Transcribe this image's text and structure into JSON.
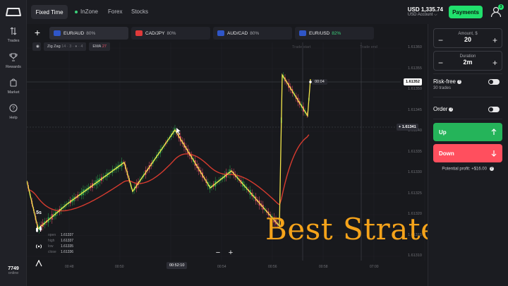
{
  "sidebar": {
    "items": [
      {
        "label": "Trades",
        "icon": "arrows-updown-icon"
      },
      {
        "label": "Rewards",
        "icon": "trophy-icon"
      },
      {
        "label": "Market",
        "icon": "cart-icon"
      },
      {
        "label": "Help",
        "icon": "help-icon"
      }
    ],
    "online_count": "7749",
    "online_label": "online"
  },
  "header": {
    "tabs": [
      {
        "label": "Fixed Time"
      },
      {
        "label": "InZone"
      },
      {
        "label": "Forex"
      },
      {
        "label": "Stocks"
      }
    ],
    "balance": "USD 1,335.74",
    "account_label": "USD Account",
    "payments_label": "Payments",
    "notification_count": "3"
  },
  "assets": [
    {
      "name": "EUR/AUD",
      "payout": "80%"
    },
    {
      "name": "CAD/JPY",
      "payout": "80%"
    },
    {
      "name": "AUD/CAD",
      "payout": "80%"
    },
    {
      "name": "EUR/USD",
      "payout": "82%"
    }
  ],
  "indicators": [
    {
      "name": "Zig Zag",
      "params": "14 · 3 · ● · 4"
    },
    {
      "name": "EMA",
      "params": "27"
    }
  ],
  "chart": {
    "timeframe": "5s",
    "ohlc": [
      {
        "key": "open",
        "value": "1.61337"
      },
      {
        "key": "high",
        "value": "1.61337"
      },
      {
        "key": "low",
        "value": "1.61335"
      },
      {
        "key": "close",
        "value": "1.61336"
      }
    ],
    "current_price": "1.61352",
    "crosshair_price": "1.61341",
    "timer": "00:04",
    "trade_start_label": "Trade start",
    "trade_end_label": "Trade end",
    "crosshair_time": "00:52:10",
    "price_axis": [
      "1.61360",
      "1.61355",
      "1.61350",
      "1.61345",
      "1.61340",
      "1.61335",
      "1.61330",
      "1.61325",
      "1.61320",
      "1.61315",
      "1.61310"
    ],
    "time_axis": [
      "00:48",
      "00:50",
      "00:54",
      "00:56",
      "00:58",
      "07:00"
    ],
    "overlay_text": "Best Strategy",
    "colors": {
      "candle_up": "#2fa84f",
      "candle_down": "#e8546a",
      "zigzag": "#f2e64a",
      "ema": "#d63b2f",
      "overlay": "#f5a31a"
    }
  },
  "panel": {
    "amount_label": "Amount, $",
    "amount_value": "20",
    "duration_label": "Duration",
    "duration_value": "2m",
    "riskfree_label": "Risk-free",
    "riskfree_sub": "30 trades",
    "order_label": "Order",
    "up_label": "Up",
    "down_label": "Down",
    "profit_text": "Potential profit: +$16.00"
  }
}
